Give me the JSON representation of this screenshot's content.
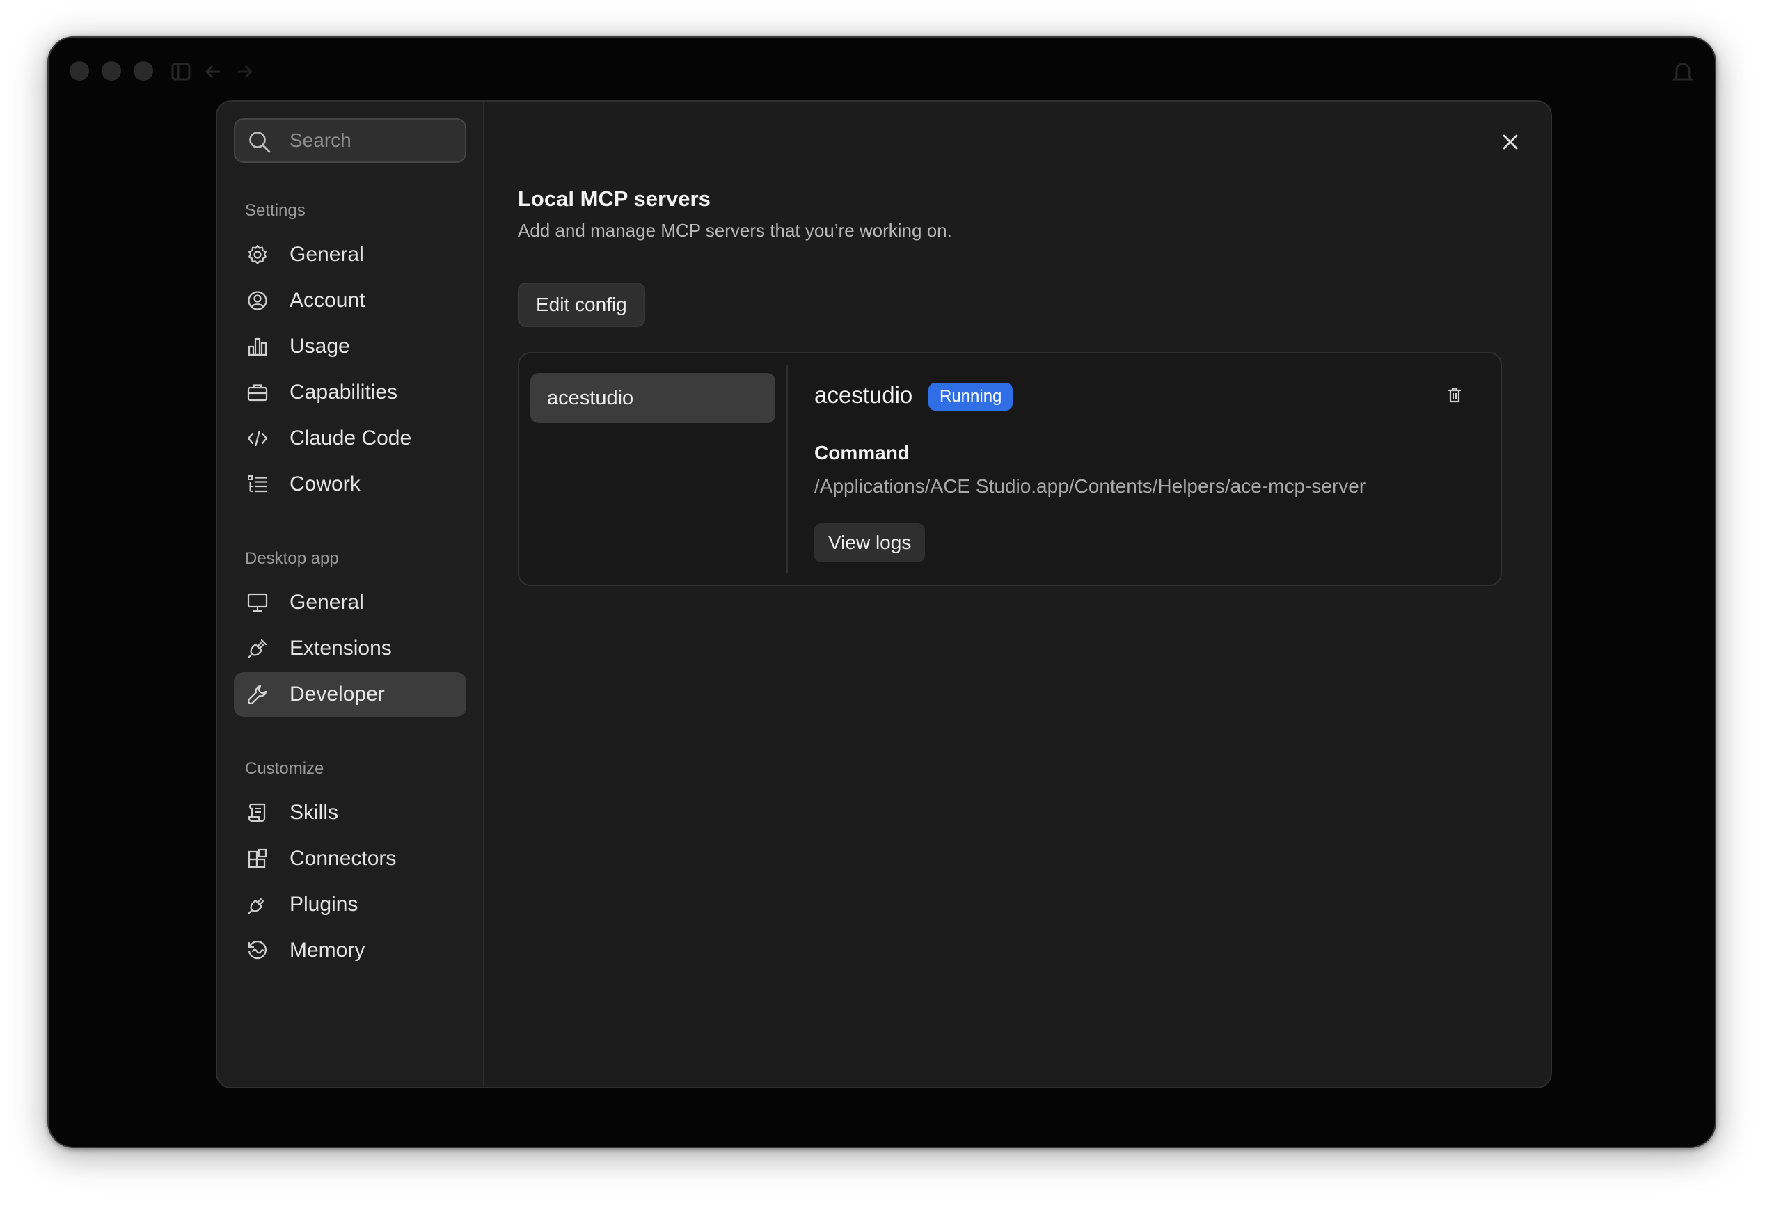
{
  "titlebar": {
    "icons": [
      "window-dot-icon",
      "sidebar-toggle-icon",
      "back-arrow-icon",
      "forward-arrow-icon",
      "notification-icon"
    ]
  },
  "search": {
    "placeholder": "Search"
  },
  "sidebar": {
    "sections": [
      {
        "label": "Settings",
        "items": [
          {
            "label": "General",
            "icon": "gear-icon"
          },
          {
            "label": "Account",
            "icon": "user-circle-icon"
          },
          {
            "label": "Usage",
            "icon": "bar-chart-icon"
          },
          {
            "label": "Capabilities",
            "icon": "briefcase-icon"
          },
          {
            "label": "Claude Code",
            "icon": "code-icon"
          },
          {
            "label": "Cowork",
            "icon": "checklist-icon"
          }
        ]
      },
      {
        "label": "Desktop app",
        "items": [
          {
            "label": "General",
            "icon": "monitor-icon"
          },
          {
            "label": "Extensions",
            "icon": "plug-icon"
          },
          {
            "label": "Developer",
            "icon": "wrench-icon",
            "active": true
          }
        ]
      },
      {
        "label": "Customize",
        "items": [
          {
            "label": "Skills",
            "icon": "scroll-icon"
          },
          {
            "label": "Connectors",
            "icon": "blocks-icon"
          },
          {
            "label": "Plugins",
            "icon": "plug-icon"
          },
          {
            "label": "Memory",
            "icon": "history-icon"
          }
        ]
      }
    ]
  },
  "main": {
    "title": "Local MCP servers",
    "subtitle": "Add and manage MCP servers that you’re working on.",
    "edit_config_label": "Edit config",
    "servers": [
      {
        "name": "acestudio"
      }
    ],
    "selected_server": {
      "name": "acestudio",
      "status": "Running",
      "command_label": "Command",
      "command": "/Applications/ACE Studio.app/Contents/Helpers/ace-mcp-server",
      "view_logs_label": "View logs"
    }
  },
  "colors": {
    "accent": "#2f6ee5",
    "window_bg": "#050505",
    "modal_bg": "#1c1c1c",
    "active_item_bg": "#3c3c3c"
  }
}
